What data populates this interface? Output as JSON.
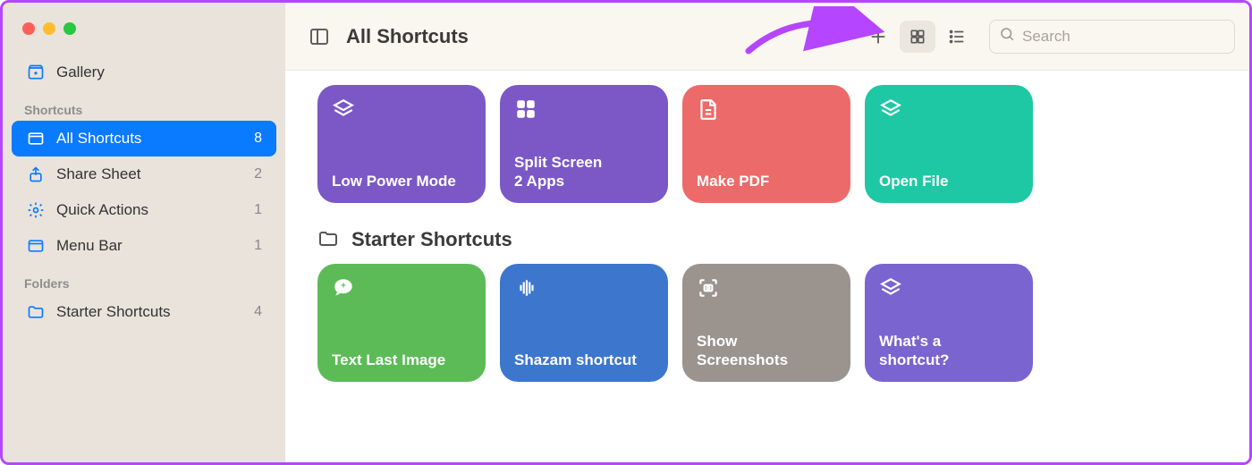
{
  "sidebar": {
    "gallery_label": "Gallery",
    "header_shortcuts": "Shortcuts",
    "header_folders": "Folders",
    "items": [
      {
        "label": "All Shortcuts",
        "count": "8"
      },
      {
        "label": "Share Sheet",
        "count": "2"
      },
      {
        "label": "Quick Actions",
        "count": "1"
      },
      {
        "label": "Menu Bar",
        "count": "1"
      }
    ],
    "folders": [
      {
        "label": "Starter Shortcuts",
        "count": "4"
      }
    ]
  },
  "toolbar": {
    "title": "All Shortcuts",
    "search_placeholder": "Search"
  },
  "section2_title": "Starter Shortcuts",
  "cards_top": [
    {
      "label": "Low Power Mode",
      "color": "#7b58c6",
      "icon": "layers"
    },
    {
      "label": "Split Screen\n2 Apps",
      "color": "#7b58c6",
      "icon": "grid4"
    },
    {
      "label": "Make PDF",
      "color": "#ec6a69",
      "icon": "doc"
    },
    {
      "label": "Open File",
      "color": "#1ec8a5",
      "icon": "layers"
    }
  ],
  "cards_bottom": [
    {
      "label": "Text Last Image",
      "color": "#5cbb57",
      "icon": "bubble"
    },
    {
      "label": "Shazam shortcut",
      "color": "#3d77cd",
      "icon": "wave"
    },
    {
      "label": "Show\nScreenshots",
      "color": "#9a938e",
      "icon": "capture"
    },
    {
      "label": "What's a\nshortcut?",
      "color": "#7a64d0",
      "icon": "layers"
    }
  ]
}
